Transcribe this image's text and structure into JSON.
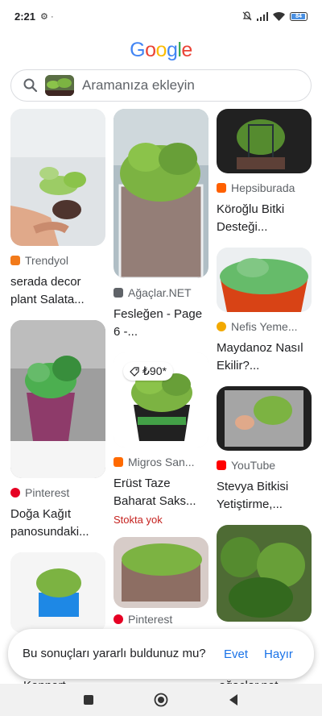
{
  "status_bar": {
    "time": "2:21",
    "battery": "84"
  },
  "logo": {
    "letters": [
      "G",
      "o",
      "o",
      "g",
      "l",
      "e"
    ],
    "colors": [
      "#4285F4",
      "#EA4335",
      "#FBBC05",
      "#4285F4",
      "#34A853",
      "#EA4335"
    ]
  },
  "search": {
    "placeholder": "Aramanıza ekleyin"
  },
  "results": {
    "col1": [
      {
        "source": "Trendyol",
        "source_color": "#f27a1a",
        "title": "serada decor plant Salata..."
      },
      {
        "source": "Pinterest",
        "source_color": "#e60023",
        "title": "Doğa Kağıt panosundaki..."
      },
      {
        "source": "",
        "source_color": "#1a73e8",
        "title": ""
      }
    ],
    "col2": [
      {
        "source": "Ağaçlar.NET",
        "source_color": "#5f6368",
        "title": "Fesleğen - Page 6 -..."
      },
      {
        "price": "₺90*",
        "source": "Migros San...",
        "source_color": "#ff6a00",
        "title": "Erüst Taze Baharat Saks...",
        "stock": "Stokta yok"
      },
      {
        "source": "Pinterest",
        "source_color": "#e60023",
        "title": ""
      }
    ],
    "col3": [
      {
        "source": "Hepsiburada",
        "source_color": "#ff6000",
        "title": "Köroğlu Bitki Desteği..."
      },
      {
        "source": "Nefis Yeme...",
        "source_color": "#f2a900",
        "title": "Maydanoz Nasıl Ekilir?..."
      },
      {
        "source": "YouTube",
        "source_color": "#ff0000",
        "title": "Stevya Bitkisi Yetiştirme,..."
      },
      {
        "source": "",
        "source_color": "#5f6368",
        "title": ""
      }
    ]
  },
  "feedback": {
    "question": "Bu sonuçları yararlı buldunuz mu?",
    "yes_label": "Evet",
    "no_label": "Hayır"
  },
  "peek_texts": {
    "col1_bottom": "Kennert...",
    "col3_bottom": "ağaçlar.net -..."
  }
}
